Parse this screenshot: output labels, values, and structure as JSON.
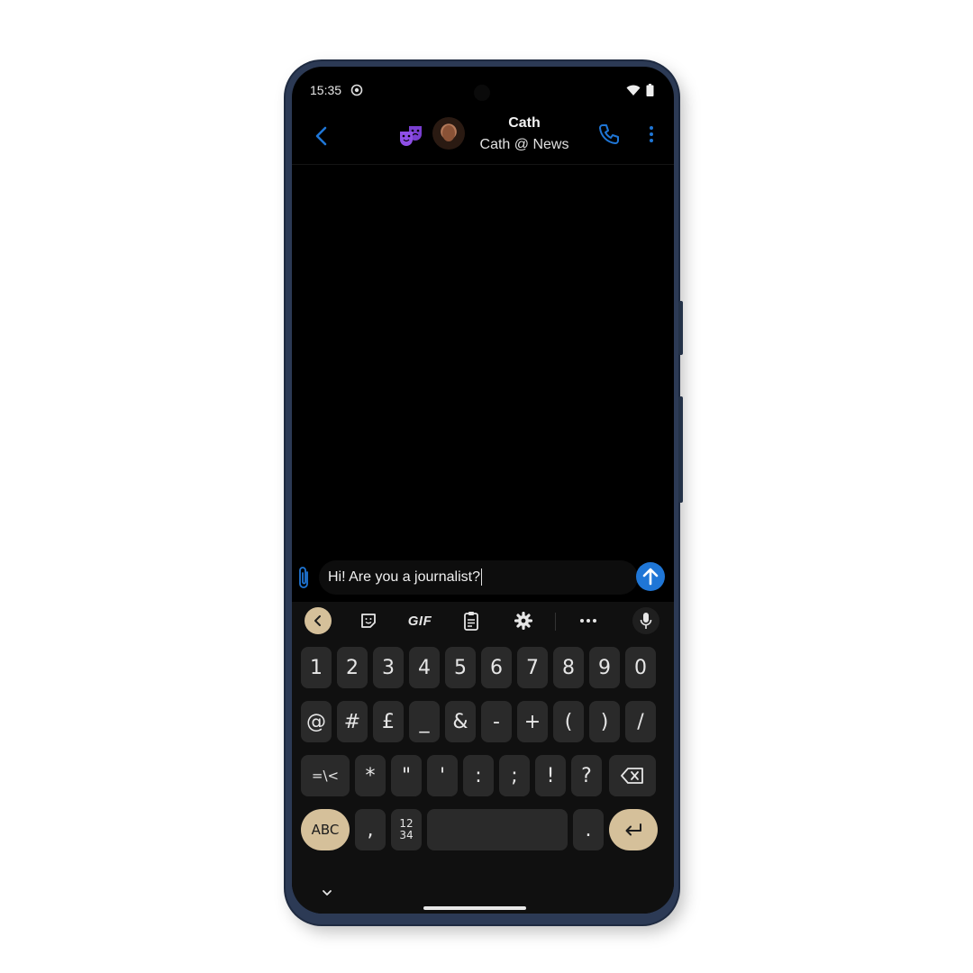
{
  "status_bar": {
    "time": "15:35"
  },
  "header": {
    "name": "Cath",
    "subtitle": "Cath @ News"
  },
  "composer": {
    "message_text": "Hi! Are you a journalist?"
  },
  "keyboard": {
    "toolbar": {
      "gif_label": "GIF"
    },
    "row1": [
      "1",
      "2",
      "3",
      "4",
      "5",
      "6",
      "7",
      "8",
      "9",
      "0"
    ],
    "row2": [
      "@",
      "#",
      "£",
      "_",
      "&",
      "-",
      "+",
      "(",
      ")",
      "/"
    ],
    "row3": [
      "=\\<",
      "*",
      "\"",
      "'",
      ":",
      ";",
      "!",
      "?"
    ],
    "row4": {
      "abc_label": "ABC",
      "comma": ",",
      "numpad_label": "12\n34",
      "period": "."
    }
  },
  "colors": {
    "accent_blue": "#1f76d6",
    "keyboard_tan": "#d5c09a",
    "theatre_purple": "#7a3fd1"
  }
}
